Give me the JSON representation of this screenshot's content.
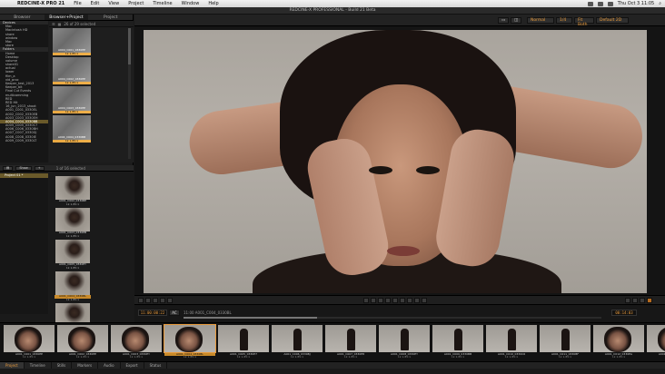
{
  "menubar": {
    "app_name": "REDCINE-X PRO 21",
    "items": [
      "File",
      "Edit",
      "View",
      "Project",
      "Timeline",
      "Window",
      "Help"
    ],
    "clock": "Thu Oct 3  11:05"
  },
  "window": {
    "title": "REDCINE-X PROFESSIONAL - Build 21 Beta"
  },
  "browser": {
    "tabs": [
      "Browser",
      "Browser+Project",
      "Project"
    ],
    "active_tab": "Browser+Project",
    "selection_count": "26 of 29 selected",
    "tree": {
      "devices_label": "Devices",
      "devices": [
        "Mac",
        "Macintosh HD",
        "share",
        "window",
        "Mac",
        "store"
      ],
      "folders_label": "Folders",
      "folders": [
        "Home",
        "Desktop"
      ],
      "files": [
        "volume",
        "share01",
        "actual",
        "lower",
        "film_a",
        "vid_proc",
        "Keeper_test_2013",
        "Keeper_bit",
        "Final Cut Events",
        "multicamming",
        "RED",
        "RED Hit",
        "16_jun_2013_shoot",
        "A001_C001_0330EL",
        "A002_C002_0330EB",
        "A003_C003_0330EH",
        "A004_C004_0330BB",
        "A005_C005_0330C7",
        "A006_C006_0330BH",
        "A007_C007_0330GJ",
        "A008_C008_0330IE",
        "A009_C009_0330LT"
      ],
      "selected_file": "A004_C004_0330BB"
    },
    "strip_clips": [
      {
        "name": "A004_C001_0330EE",
        "fps": "1k 1.85:1"
      },
      {
        "name": "A004_C002_0330EE",
        "fps": "1k 1.85:1"
      },
      {
        "name": "A004_C003_0330EE",
        "fps": "1k 1.85:1"
      },
      {
        "name": "A004_C004_0330BB",
        "fps": "1k 1.85:1"
      }
    ]
  },
  "project": {
    "toolbar_btn1": "Show",
    "count_label": "1 of 16 selected",
    "items": [
      "Project 01 *"
    ],
    "clips": [
      {
        "name": "A001_C002_0330BE",
        "fps": "1k 1.85:1"
      },
      {
        "name": "A001_C003_0330EB",
        "fps": "1k 1.85:1"
      },
      {
        "name": "A001_C005_0330EY",
        "fps": "1k 1.85:1"
      },
      {
        "name": "A001_C004_0330BL",
        "fps": "1k 1.85:1"
      },
      {
        "name": "A001_C006_0330BH",
        "fps": "1k 1.85:1"
      }
    ]
  },
  "viewer_toolbar": {
    "mode": "Normal",
    "res": "1/4",
    "fit": "Fit Both",
    "lut": "Default 2D"
  },
  "timeline": {
    "timecode": "11:00:00:22",
    "tag": "AC",
    "clip_info": "11:00 A001_C004_0330BL",
    "end_timecode": "00:14:03",
    "progress": 0.32
  },
  "filmstrip": [
    {
      "name": "A001_C001_0330EE",
      "fps": "1k 1.85:1",
      "close": true
    },
    {
      "name": "A001_C002_0330EE",
      "fps": "1k 1.85:1",
      "close": true
    },
    {
      "name": "A001_C003_0330EY",
      "fps": "1k 1.85:1",
      "close": true
    },
    {
      "name": "A001_C004_0330BL",
      "fps": "1k 1.85:1",
      "close": true,
      "selected": true
    },
    {
      "name": "A001_C005_0330E7",
      "fps": "1k 1.85:1",
      "close": false
    },
    {
      "name": "A001_C006_0330BJ",
      "fps": "1k 1.85:1",
      "close": false
    },
    {
      "name": "A001_C007_0330E8",
      "fps": "1k 1.85:1",
      "close": false
    },
    {
      "name": "A001_C008_0330EY",
      "fps": "1k 1.85:1",
      "close": false
    },
    {
      "name": "A001_C009_0330BB",
      "fps": "1k 1.85:1",
      "close": false
    },
    {
      "name": "A001_C010_0330C6",
      "fps": "1k 1.85:1",
      "close": false
    },
    {
      "name": "A001_C011_0330BF",
      "fps": "1k 1.85:1",
      "close": false
    },
    {
      "name": "A001_C012_0330EA",
      "fps": "1k 1.85:1",
      "close": true
    },
    {
      "name": "A001_C013_0330EB",
      "fps": "1k 1.85:1",
      "close": true
    }
  ],
  "bottom_tabs": [
    "Project",
    "Timeline",
    "Stills",
    "Markers",
    "Audio",
    "Export",
    "Status"
  ],
  "active_bottom_tab": "Project",
  "colors": {
    "accent": "#e89a3c",
    "selection": "#6a5a2a"
  }
}
